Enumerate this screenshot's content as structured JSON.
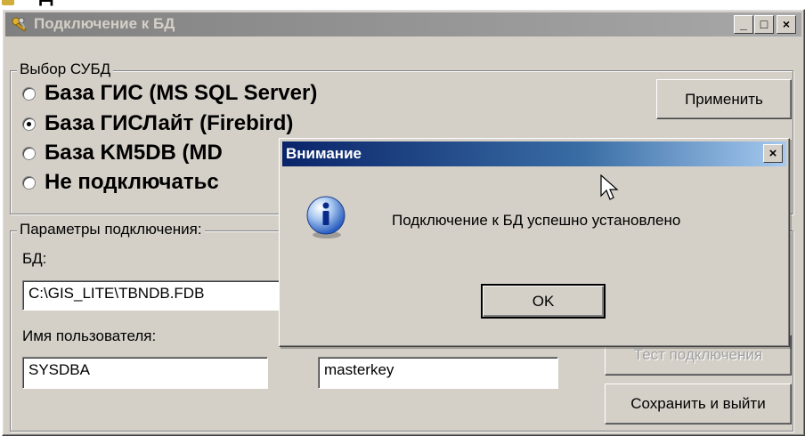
{
  "background_partial": {
    "top_glyph": "Д"
  },
  "main_window": {
    "title": "Подключение к БД",
    "minimize_glyph": "_",
    "maximize_glyph": "□",
    "close_glyph": "×",
    "dbms_group": {
      "legend": "Выбор СУБД",
      "options": [
        {
          "label": "База ГИС (MS SQL Server)",
          "checked": false
        },
        {
          "label": "База ГИСЛайт (Firebird)",
          "checked": true
        },
        {
          "label": "База KM5DB (MD",
          "checked": false
        },
        {
          "label": "Не подключатьс",
          "checked": false
        }
      ],
      "apply_button": "Применить"
    },
    "params_group": {
      "legend": "Параметры подключения: ",
      "db_label": "БД:",
      "db_value": "C:\\GIS_LITE\\TBNDB.FDB",
      "user_label": "Имя пользователя:",
      "user_value": "SYSDBA",
      "password_value": "masterkey",
      "test_button": "Тест подключения",
      "save_button": "Сохранить и выйти"
    }
  },
  "dialog": {
    "title": "Внимание",
    "close_glyph": "×",
    "message": "Подключение к БД успешно установлено",
    "ok_button": "OK",
    "icon": "info-icon"
  }
}
